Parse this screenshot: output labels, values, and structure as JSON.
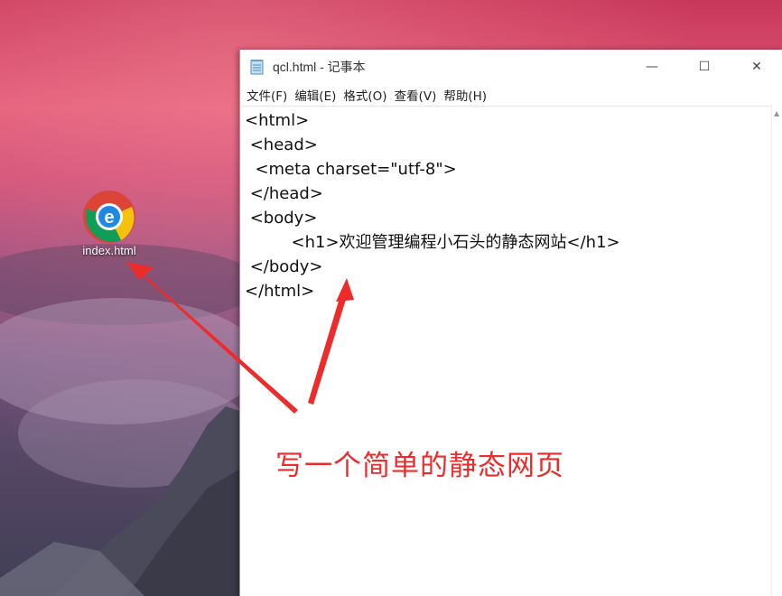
{
  "desktop": {
    "icon_label": "index.html",
    "icon_type": "browser-icon"
  },
  "notepad": {
    "title": "qcl.html - 记事本",
    "window_buttons": {
      "minimize": "—",
      "maximize": "☐",
      "close": "✕"
    },
    "menu": [
      {
        "label": "文件(F)"
      },
      {
        "label": "编辑(E)"
      },
      {
        "label": "格式(O)"
      },
      {
        "label": "查看(V)"
      },
      {
        "label": "帮助(H)"
      }
    ],
    "code_lines": [
      "<html>",
      " <head>",
      "  <meta charset=\"utf-8\">",
      " </head>",
      " <body>",
      "         <h1>欢迎管理编程小石头的静态网站</h1>",
      " </body>",
      "</html>"
    ]
  },
  "annotation": {
    "text": "写一个简单的静态网页",
    "color": "#ee2b2b"
  }
}
